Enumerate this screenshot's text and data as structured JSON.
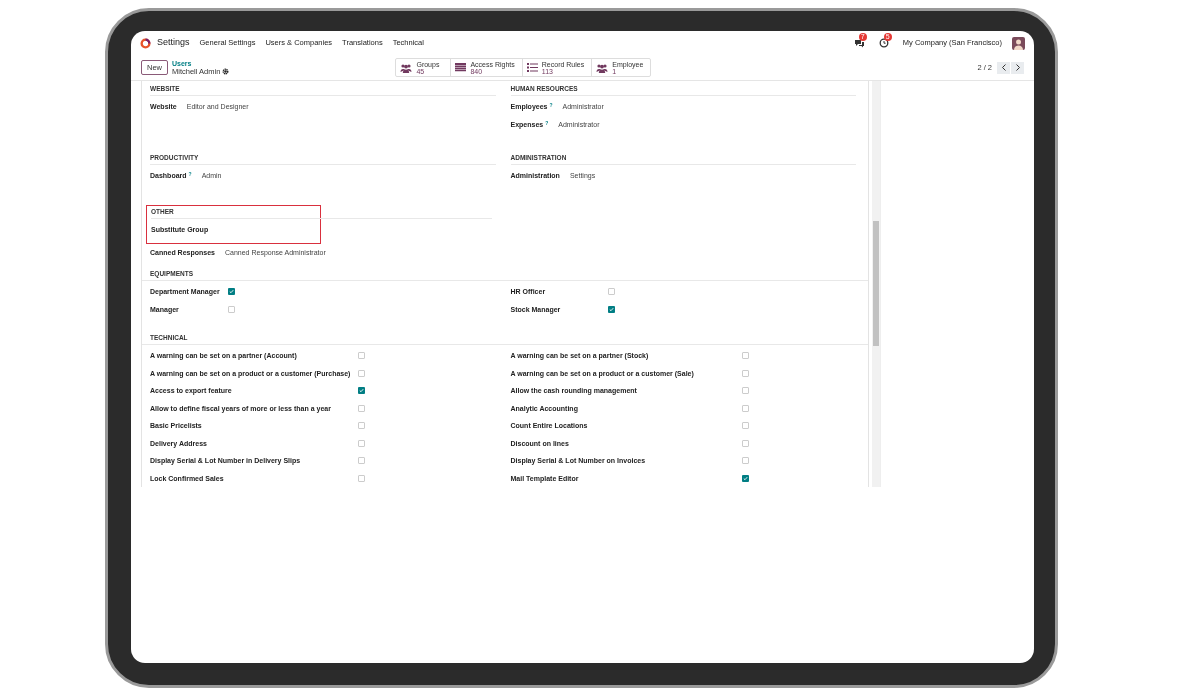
{
  "navbar": {
    "app": "Settings",
    "menu": [
      "General Settings",
      "Users & Companies",
      "Translations",
      "Technical"
    ],
    "chat_badge": "7",
    "activity_badge": "5",
    "company": "My Company (San Francisco)"
  },
  "control_panel": {
    "new_button": "New",
    "breadcrumb": "Users",
    "record": "Mitchell Admin",
    "pager": "2 / 2",
    "smart_buttons": [
      {
        "kind": "people",
        "label": "Groups",
        "count": "45"
      },
      {
        "kind": "table",
        "label": "Access Rights",
        "count": "840"
      },
      {
        "kind": "list",
        "label": "Record Rules",
        "count": "113"
      },
      {
        "kind": "people",
        "label": "Employee",
        "count": "1"
      }
    ]
  },
  "half_sections": [
    [
      {
        "title": "WEBSITE",
        "highlighted": false,
        "fields": [
          {
            "label": "Website",
            "value": "Editor and Designer"
          }
        ]
      },
      {
        "title": "HUMAN RESOURCES",
        "highlighted": false,
        "fields": [
          {
            "label": "Employees",
            "help": "?",
            "value": "Administrator"
          },
          {
            "label": "Expenses",
            "help": "?",
            "value": "Administrator"
          }
        ]
      }
    ],
    [
      {
        "title": "PRODUCTIVITY",
        "highlighted": false,
        "fields": [
          {
            "label": "Dashboard",
            "help": "?",
            "value": "Admin"
          }
        ]
      },
      {
        "title": "ADMINISTRATION",
        "highlighted": false,
        "fields": [
          {
            "label": "Administration",
            "value": "Settings"
          }
        ]
      }
    ],
    [
      {
        "title": "OTHER",
        "highlighted": true,
        "fields": [
          {
            "label": "Substitute Group"
          },
          {
            "label": "Canned Responses",
            "value": "Canned Response Administrator"
          }
        ]
      }
    ]
  ],
  "full_sections": [
    {
      "title": "EQUIPMENTS",
      "columns": [
        [
          {
            "label": "Department Manager",
            "checked": true
          },
          {
            "label": "Manager",
            "checked": false
          }
        ],
        [
          {
            "label": "HR Officer",
            "checked": false
          },
          {
            "label": "Stock Manager",
            "checked": true
          }
        ]
      ]
    },
    {
      "title": "TECHNICAL",
      "columns": [
        [
          {
            "label": "A warning can be set on a partner (Account)",
            "checked": false
          },
          {
            "label": "A warning can be set on a product or a customer (Purchase)",
            "checked": false
          },
          {
            "label": "Access to export feature",
            "checked": true
          },
          {
            "label": "Allow to define fiscal years of more or less than a year",
            "checked": false
          },
          {
            "label": "Basic Pricelists",
            "checked": false
          },
          {
            "label": "Delivery Address",
            "checked": false
          },
          {
            "label": "Display Serial & Lot Number in Delivery Slips",
            "checked": false
          },
          {
            "label": "Lock Confirmed Sales",
            "checked": false
          }
        ],
        [
          {
            "label": "A warning can be set on a partner (Stock)",
            "checked": false
          },
          {
            "label": "A warning can be set on a product or a customer (Sale)",
            "checked": false
          },
          {
            "label": "Allow the cash rounding management",
            "checked": false
          },
          {
            "label": "Analytic Accounting",
            "checked": false
          },
          {
            "label": "Count Entire Locations",
            "checked": false
          },
          {
            "label": "Discount on lines",
            "checked": false
          },
          {
            "label": "Display Serial & Lot Number on Invoices",
            "checked": false
          },
          {
            "label": "Mail Template Editor",
            "checked": true
          }
        ]
      ]
    }
  ]
}
